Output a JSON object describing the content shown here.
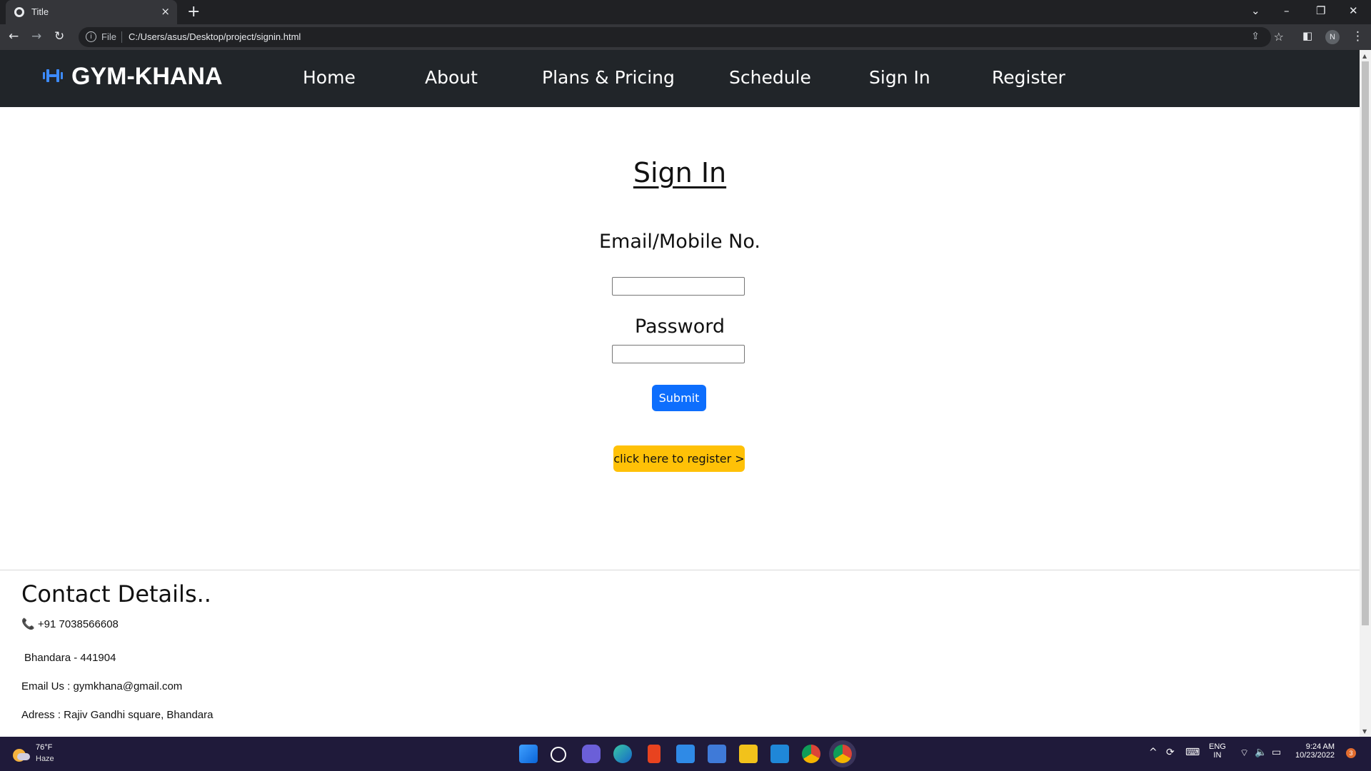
{
  "browser": {
    "tab_title": "Title",
    "new_tab_icon": "+",
    "close_tab_icon": "×",
    "address_scheme": "File",
    "address_url": "C:/Users/asus/Desktop/project/signin.html",
    "profile_initial": "N"
  },
  "navbar": {
    "brand": "GYM-KHANA",
    "links": [
      "Home",
      "About",
      "Plans & Pricing",
      "Schedule",
      "Sign In",
      "Register"
    ]
  },
  "signin": {
    "title": "Sign In",
    "email_label": "Email/Mobile No.",
    "password_label": "Password",
    "submit_label": "Submit",
    "register_label": "click here to register >"
  },
  "contact": {
    "title": "Contact Details..",
    "phone": "+91 7038566608",
    "city": "Bhandara - 441904",
    "email": "Email Us : gymkhana@gmail.com",
    "address": "Adress : Rajiv Gandhi square, Bhandara"
  },
  "taskbar": {
    "weather_temp": "76°F",
    "weather_cond": "Haze",
    "lang_top": "ENG",
    "lang_bottom": "IN",
    "time": "9:24 AM",
    "date": "10/23/2022",
    "notification_count": "3"
  },
  "colors": {
    "navbar_bg": "#212529",
    "submit_bg": "#0d6efd",
    "register_bg": "#ffc107",
    "brand_icon": "#3d8bfd",
    "taskbar_bg": "#1f1a3a"
  }
}
